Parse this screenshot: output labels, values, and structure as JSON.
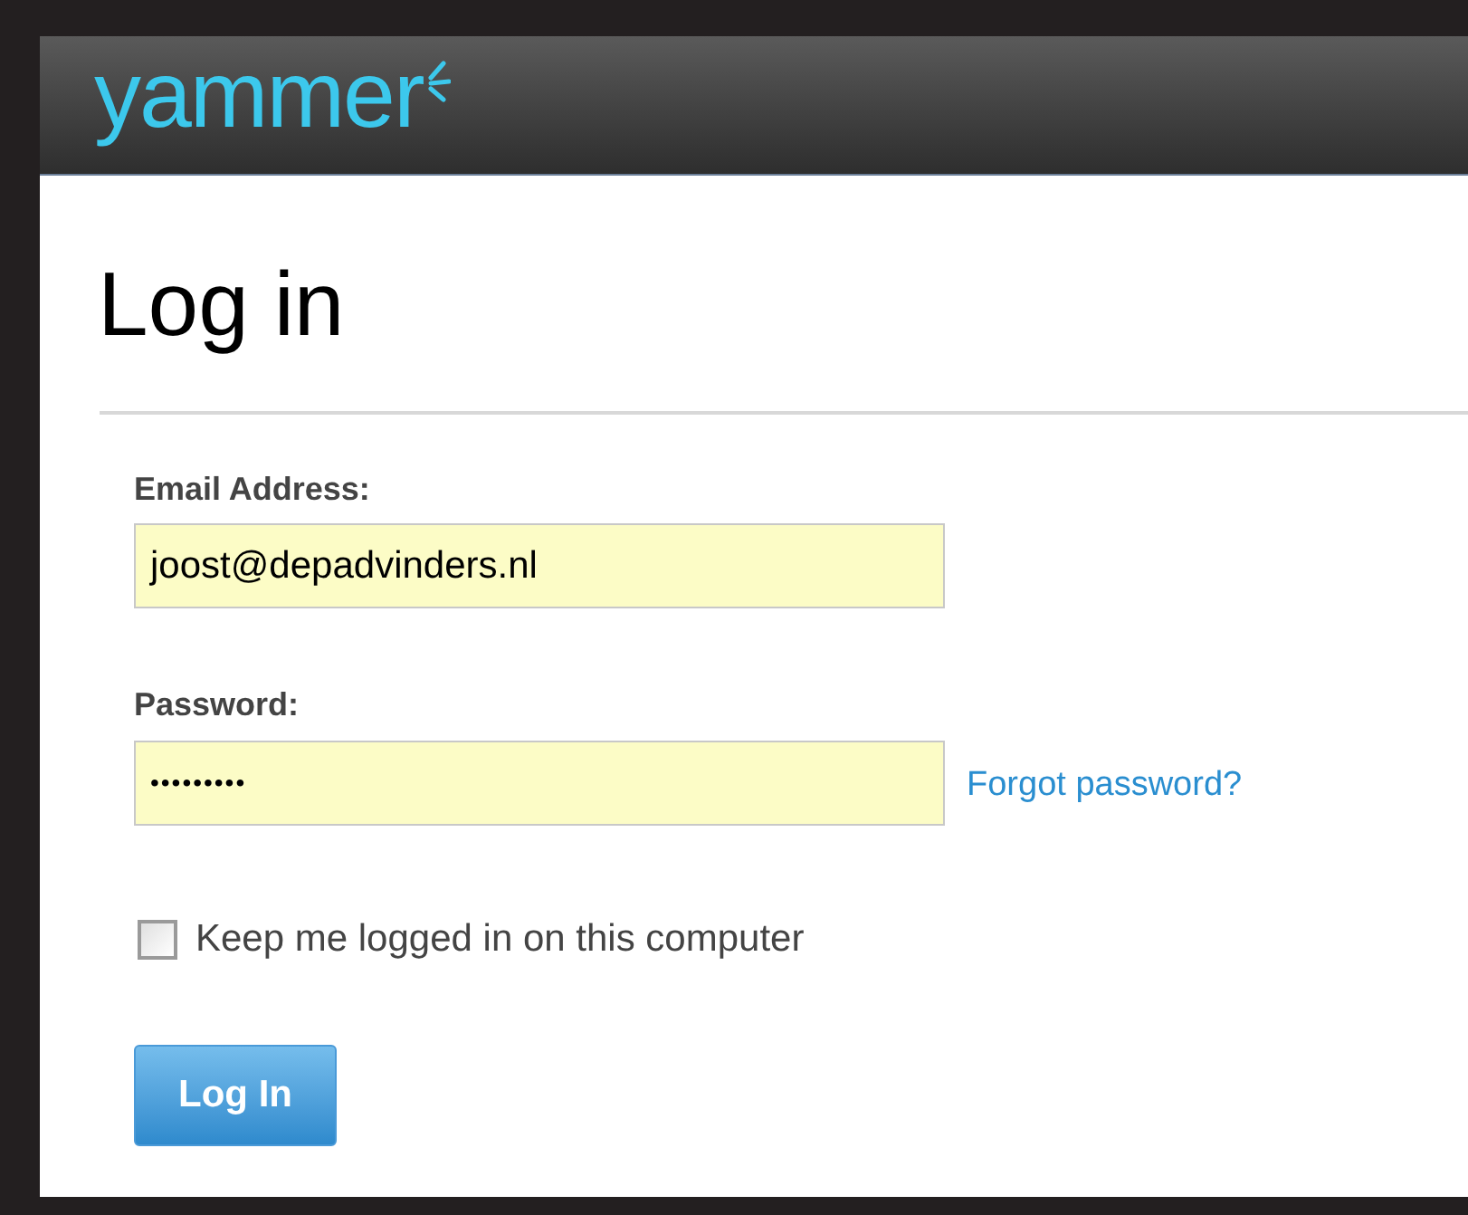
{
  "header": {
    "logo": "yammer"
  },
  "title": "Log in",
  "form": {
    "email": {
      "label": "Email Address:",
      "value": "joost@depadvinders.nl"
    },
    "password": {
      "label": "Password:",
      "value": "•••••••••",
      "link": "Forgot password?"
    },
    "remember": {
      "label": "Keep me logged in on this computer",
      "checked": false
    },
    "submit": "Log In"
  }
}
